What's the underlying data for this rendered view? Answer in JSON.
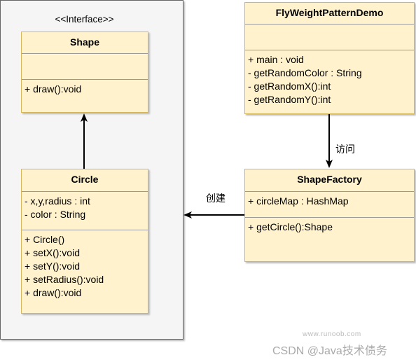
{
  "stereotype": "<<Interface>>",
  "shape": {
    "name": "Shape",
    "attributes": [],
    "methods": [
      "+ draw():void"
    ]
  },
  "circle": {
    "name": "Circle",
    "attributes": [
      "- x,y,radius : int",
      "- color : String"
    ],
    "methods": [
      "+ Circle()",
      "+ setX():void",
      "+ setY():void",
      "+ setRadius():void",
      "+ draw():void"
    ]
  },
  "demo": {
    "name": "FlyWeightPatternDemo",
    "attributes": [],
    "methods": [
      "+ main : void",
      "- getRandomColor : String",
      "- getRandomX():int",
      "- getRandomY():int"
    ]
  },
  "factory": {
    "name": "ShapeFactory",
    "attributes": [
      "+ circleMap : HashMap"
    ],
    "methods": [
      "+ getCircle():Shape"
    ]
  },
  "edges": {
    "visit": "访问",
    "create": "创建"
  },
  "watermark": {
    "site": "www.runoob.com",
    "csdn": "CSDN @Java技术债务"
  },
  "colors": {
    "class_fill": "#fff2cc",
    "class_border": "#d6b656",
    "container_fill": "#f5f5f5"
  }
}
